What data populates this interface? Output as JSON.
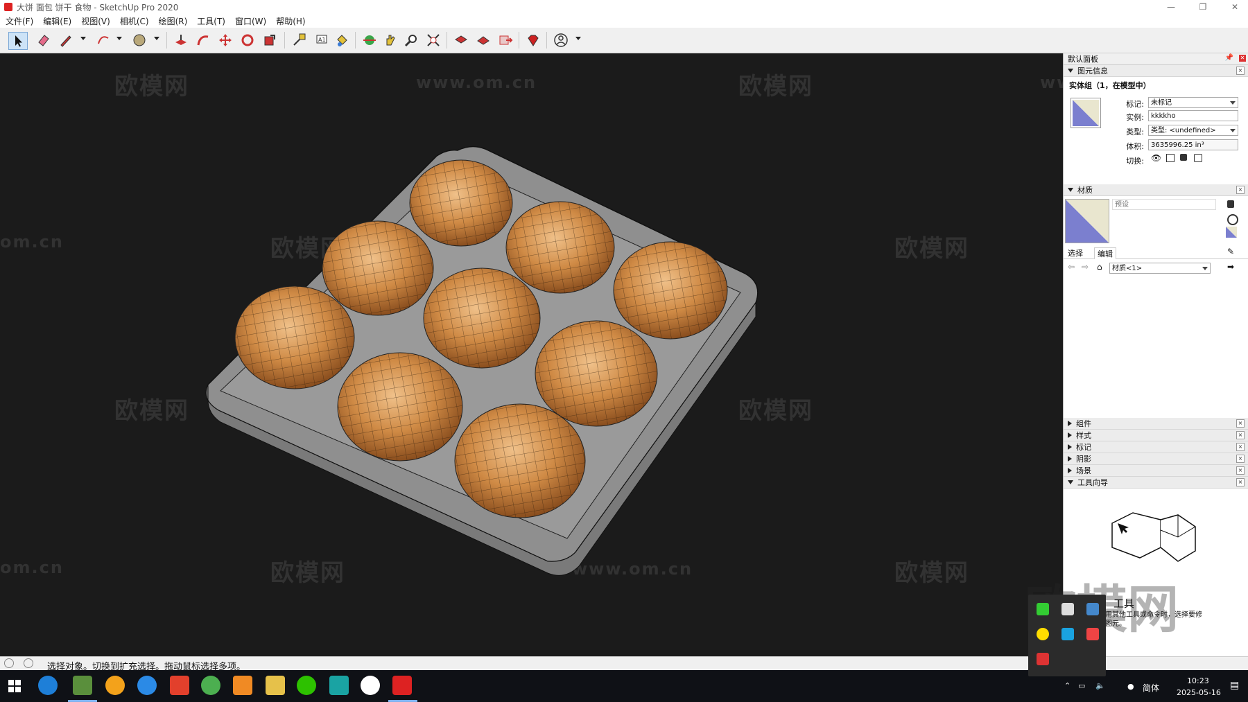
{
  "window": {
    "title": "大饼 面包 饼干 食物 - SketchUp Pro 2020",
    "minimize": "—",
    "restore": "❐",
    "close": "✕"
  },
  "menu": [
    "文件(F)",
    "编辑(E)",
    "视图(V)",
    "相机(C)",
    "绘图(R)",
    "工具(T)",
    "窗口(W)",
    "帮助(H)"
  ],
  "watermarks": {
    "brand": "欧模网",
    "url": "www.om.cn",
    "partial": "om.cn",
    "url_partial": "ww"
  },
  "panel": {
    "title": "默认面板",
    "entity_info": {
      "header": "图元信息",
      "subtitle": "实体组（1，在模型中）",
      "tag_label": "标记:",
      "tag_value": "未标记",
      "instance_label": "实例:",
      "instance_value": "kkkkho",
      "type_label": "类型:",
      "type_value": "类型: <undefined>",
      "volume_label": "体积:",
      "volume_value": "3635996.25 in³",
      "toggle_label": "切换:"
    },
    "materials": {
      "header": "材质",
      "name_placeholder": "预设",
      "tab_select": "选择",
      "tab_edit": "编辑",
      "library_value": "材质<1>"
    },
    "collapsed_sections": [
      "组件",
      "样式",
      "标记",
      "阴影",
      "场景"
    ],
    "instructor": {
      "header": "工具向导",
      "title": "工具",
      "desc_line1": "用其他工具或命令时，选择要修",
      "desc_line2": "图元。"
    }
  },
  "status": {
    "text": "选择对象。切换到扩充选择。拖动鼠标选择多项。"
  },
  "taskbar": {
    "ime": "简体",
    "time": "10:23",
    "date": "2025-05-16"
  },
  "colors": {
    "viewport_bg": "#1b1b1b",
    "tray_fill": "#8e8e8e",
    "bun": "#c98a4a",
    "swatch": "#7b7fcf"
  }
}
